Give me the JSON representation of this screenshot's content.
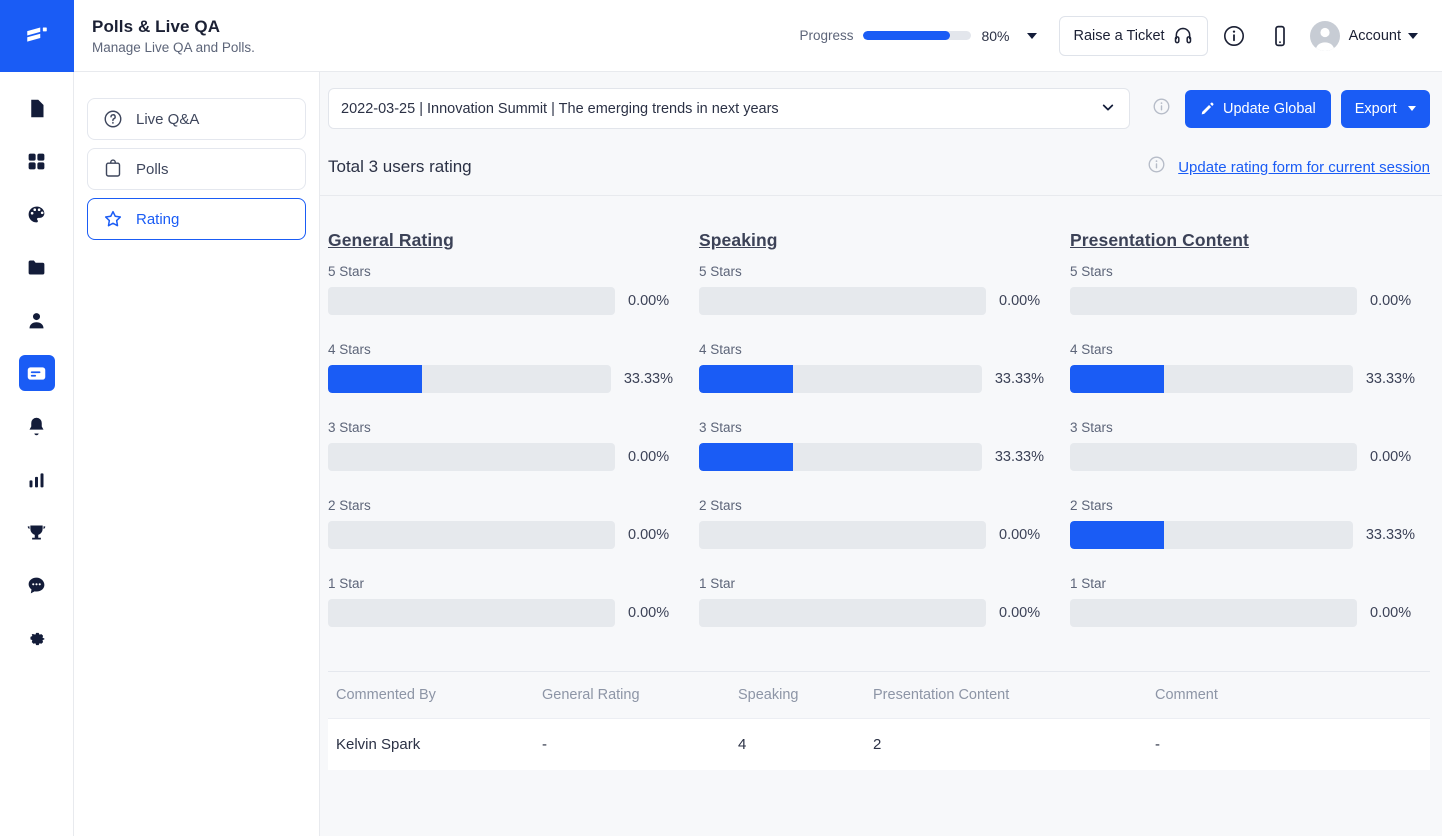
{
  "brand": {
    "accent": "#1a5cf5",
    "logo_icon": "stacked-bars-logo"
  },
  "header": {
    "title": "Polls & Live QA",
    "subtitle": "Manage Live QA and Polls.",
    "progress_label": "Progress",
    "progress_percent": "80%",
    "progress_value": 80,
    "raise_ticket_label": "Raise a Ticket",
    "account_label": "Account",
    "icons": [
      "headset-icon",
      "info-circle-icon",
      "mobile-icon",
      "avatar-icon",
      "chevron-down-icon"
    ]
  },
  "rail": {
    "items": [
      {
        "name": "document",
        "active": false
      },
      {
        "name": "grid",
        "active": false
      },
      {
        "name": "palette",
        "active": false
      },
      {
        "name": "folder",
        "active": false
      },
      {
        "name": "person",
        "active": false
      },
      {
        "name": "polls",
        "active": true
      },
      {
        "name": "bell",
        "active": false
      },
      {
        "name": "bar-chart",
        "active": false
      },
      {
        "name": "trophy",
        "active": false
      },
      {
        "name": "chat",
        "active": false
      },
      {
        "name": "gear",
        "active": false
      }
    ]
  },
  "leftnav": {
    "items": [
      {
        "label": "Live Q&A",
        "icon": "question-circle-icon",
        "active": false
      },
      {
        "label": "Polls",
        "icon": "clipboard-icon",
        "active": false
      },
      {
        "label": "Rating",
        "icon": "star-icon",
        "active": true
      }
    ]
  },
  "toolbar": {
    "session_value": "2022-03-25 | Innovation Summit | The emerging trends in next years",
    "update_global_label": "Update Global",
    "export_label": "Export",
    "info_icon": "info-circle-icon",
    "pencil_icon": "pencil-icon"
  },
  "summary": {
    "total_text": "Total 3 users rating",
    "update_link": "Update rating form for current session",
    "info_icon": "info-circle-icon"
  },
  "chart_data": {
    "type": "bar",
    "title": "Total 3 users rating",
    "categories": [
      "5 Stars",
      "4 Stars",
      "3 Stars",
      "2 Stars",
      "1 Star"
    ],
    "value_labels": [
      [
        "0.00%",
        "33.33%",
        "0.00%",
        "0.00%",
        "0.00%"
      ],
      [
        "0.00%",
        "33.33%",
        "33.33%",
        "0.00%",
        "0.00%"
      ],
      [
        "0.00%",
        "33.33%",
        "0.00%",
        "33.33%",
        "0.00%"
      ]
    ],
    "series": [
      {
        "name": "General Rating",
        "values": [
          0,
          33.33,
          0,
          0,
          0
        ]
      },
      {
        "name": "Speaking",
        "values": [
          0,
          33.33,
          33.33,
          0,
          0
        ]
      },
      {
        "name": "Presentation Content",
        "values": [
          0,
          33.33,
          0,
          33.33,
          0
        ]
      }
    ],
    "ylim": [
      0,
      100
    ],
    "ylabel": "",
    "xlabel": "",
    "grid": false,
    "legend": "none"
  },
  "table": {
    "columns": [
      "Commented By",
      "General Rating",
      "Speaking",
      "Presentation Content",
      "Comment"
    ],
    "rows": [
      {
        "commented_by": "Kelvin Spark",
        "general_rating": "-",
        "speaking": "4",
        "presentation_content": "2",
        "comment": "-"
      }
    ]
  }
}
